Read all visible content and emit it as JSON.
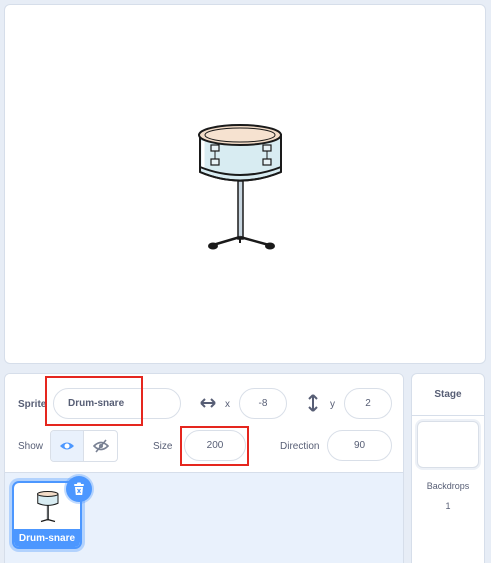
{
  "sprite_info": {
    "sprite_label": "Sprite",
    "sprite_name": "Drum-snare",
    "x_label": "x",
    "x_value": "-8",
    "y_label": "y",
    "y_value": "2",
    "show_label": "Show",
    "size_label": "Size",
    "size_value": "200",
    "direction_label": "Direction",
    "direction_value": "90"
  },
  "sprites": [
    {
      "name": "Drum-snare",
      "selected": true
    }
  ],
  "stage_panel": {
    "title": "Stage",
    "backdrops_label": "Backdrops",
    "backdrops_count": "1"
  },
  "colors": {
    "accent": "#4c97ff",
    "highlight": "#e5261e"
  }
}
